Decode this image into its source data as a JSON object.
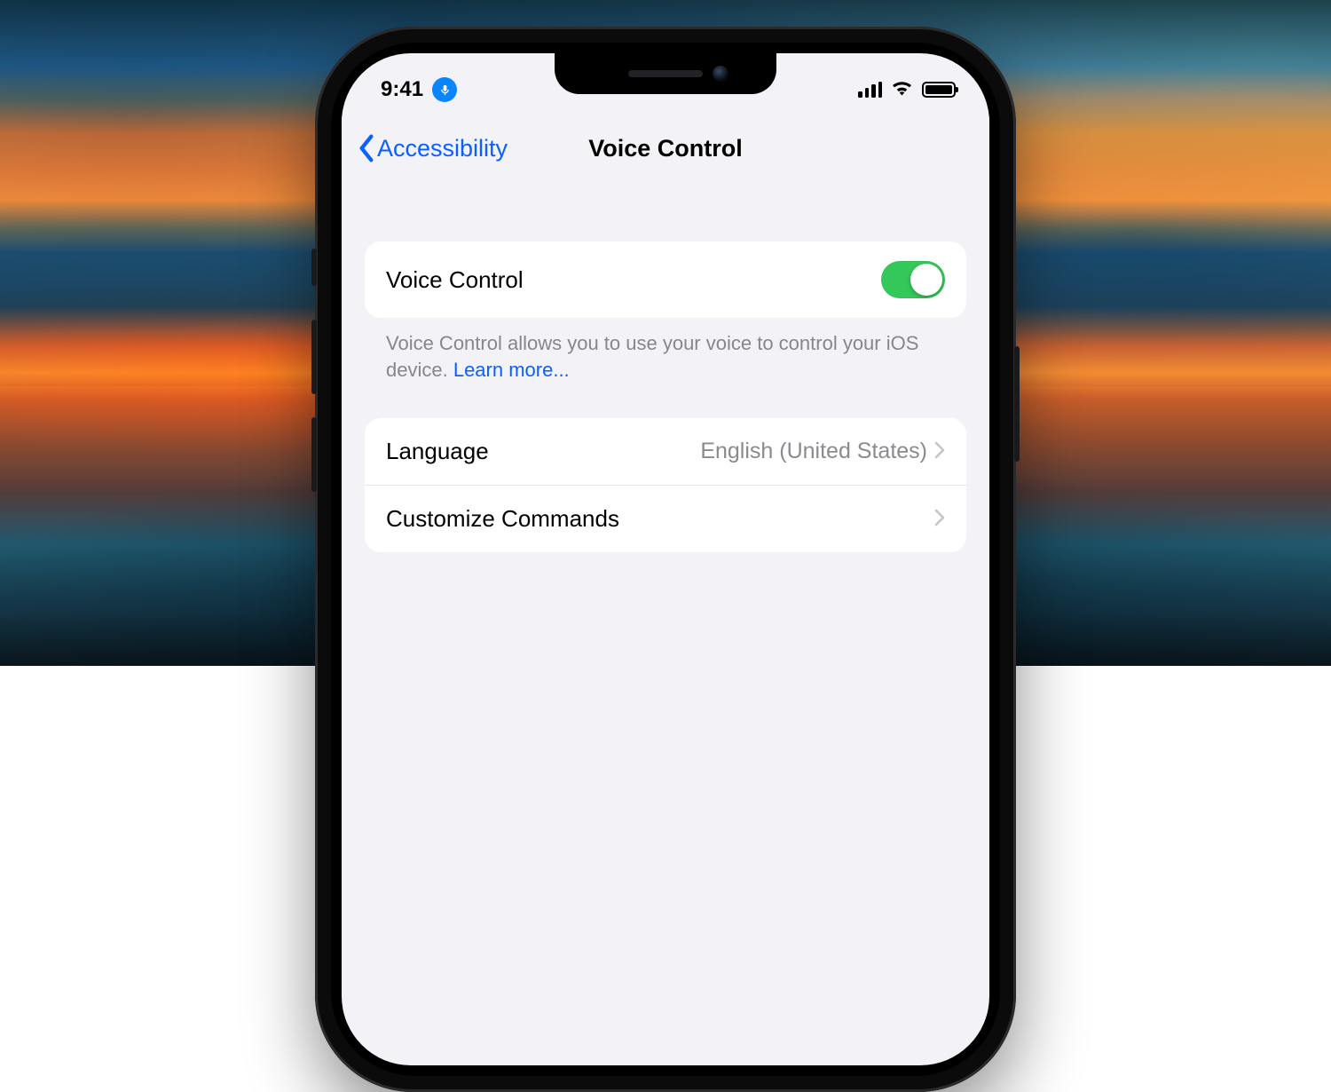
{
  "status": {
    "time": "9:41"
  },
  "nav": {
    "back_label": "Accessibility",
    "title": "Voice Control"
  },
  "toggle_row": {
    "label": "Voice Control",
    "on": true
  },
  "footer": {
    "text": "Voice Control allows you to use your voice to control your iOS device. ",
    "link": "Learn more..."
  },
  "rows": {
    "language": {
      "label": "Language",
      "value": "English (United States)"
    },
    "customize": {
      "label": "Customize Commands"
    }
  },
  "colors": {
    "accent": "#0a60ff",
    "toggle_on": "#34c759"
  }
}
